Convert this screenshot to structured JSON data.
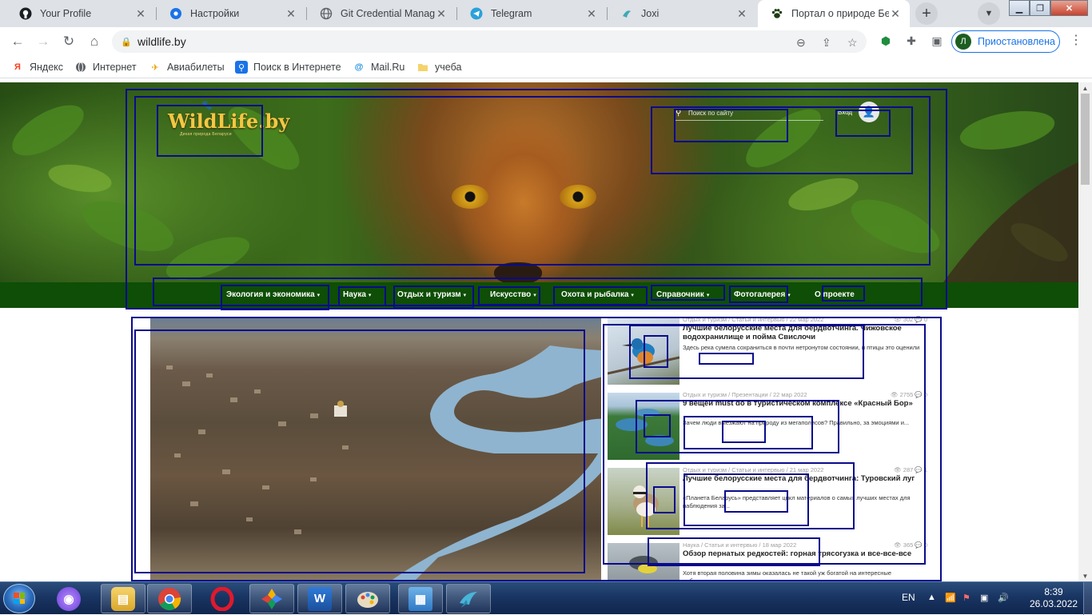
{
  "browser": {
    "tabs": [
      {
        "title": "Your Profile",
        "icon": "github-icon"
      },
      {
        "title": "Настройки",
        "icon": "settings-gear-icon"
      },
      {
        "title": "Git Credential Manager",
        "icon": "globe-icon"
      },
      {
        "title": "Telegram",
        "icon": "telegram-icon"
      },
      {
        "title": "Joxi",
        "icon": "joxi-icon"
      },
      {
        "title": "Портал о природе Беларуси",
        "icon": "paw-icon",
        "active": true
      }
    ],
    "url": "wildlife.by",
    "profile_initial": "Л",
    "profile_status": "Приостановлена",
    "bookmarks": [
      {
        "label": "Яндекс",
        "icon": "yandex-icon"
      },
      {
        "label": "Интернет",
        "icon": "globe-icon"
      },
      {
        "label": "Авиабилеты",
        "icon": "plane-icon"
      },
      {
        "label": "Поиск в Интернете",
        "icon": "search-icon"
      },
      {
        "label": "Mail.Ru",
        "icon": "mailru-icon"
      },
      {
        "label": "учеба",
        "icon": "folder-icon"
      }
    ]
  },
  "site": {
    "logo_text": "WildLife.by",
    "logo_subtitle": "Дикая природа Беларуси",
    "search_placeholder": "Поиск по сайту",
    "login_label": "Вход",
    "nav": [
      {
        "label": "Экология и экономика",
        "has_dropdown": true
      },
      {
        "label": "Наука",
        "has_dropdown": true
      },
      {
        "label": "Отдых и туризм",
        "has_dropdown": true
      },
      {
        "label": "Искусство",
        "has_dropdown": true
      },
      {
        "label": "Охота и рыбалка",
        "has_dropdown": true
      },
      {
        "label": "Справочник",
        "has_dropdown": true
      },
      {
        "label": "Фотогалерея",
        "has_dropdown": true
      },
      {
        "label": "О проекте",
        "has_dropdown": false
      }
    ],
    "articles": [
      {
        "meta": "Отдых и туризм / Статьи и интервью / 22 мар 2022",
        "views": "302",
        "comments": "0",
        "title": "Лучшие белорусские места для бердвотчинга. Чижовское водохранилище и пойма Свислочи",
        "excerpt": "Здесь река сумела сохраниться в почти нетронутом состоянии, и птицы это оценили",
        "thumb": "kingfisher"
      },
      {
        "meta": "Отдых и туризм / Презентации / 22 мар 2022",
        "views": "2755",
        "comments": "0",
        "title": "9 вещей must do в туристическом комплексе «Красный Бор»",
        "excerpt": "Зачем люди выезжают на природу из мегаполисов? Правильно, за эмоциями и...",
        "thumb": "lakes"
      },
      {
        "meta": "Отдых и туризм / Статьи и интервью / 21 мар 2022",
        "views": "287",
        "comments": "1",
        "title": "Лучшие белорусские места для бердвотчинга: Туровский луг",
        "excerpt": "«Планета Беларусь» представляет цикл материалов о самых лучших местах для наблюдения за...",
        "thumb": "plover"
      },
      {
        "meta": "Наука / Статьи и интервью / 18 мар 2022",
        "views": "365",
        "comments": "0",
        "title": "Обзор пернатых редкостей: горная трясогузка и все-все-все",
        "excerpt": "Хотя вторая половина зимы оказалась не такой уж богатой на интересные наблюдения, все же...",
        "thumb": "wagtail"
      }
    ]
  },
  "taskbar": {
    "lang": "EN",
    "time": "8:39",
    "date": "26.03.2022",
    "apps": [
      "alice-icon",
      "file-explorer-icon",
      "chrome-icon",
      "opera-icon",
      "color-picker-icon",
      "word-icon",
      "paint-icon",
      "control-panel-icon",
      "bird-app-icon"
    ]
  },
  "colors": {
    "nav_bg": "#0e4e06",
    "tab_strip": "#dee1e6",
    "accent_blue": "#1a73e8",
    "annotation_box": "#0a0a8c"
  }
}
